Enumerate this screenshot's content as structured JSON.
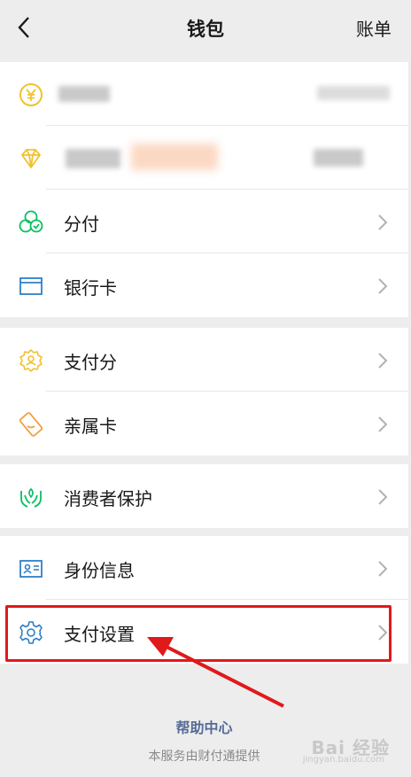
{
  "header": {
    "title": "钱包",
    "bill_label": "账单"
  },
  "menu": {
    "fenfu": "分付",
    "bank_card": "银行卡",
    "pay_score": "支付分",
    "family_card": "亲属卡",
    "consumer_protection": "消费者保护",
    "identity_info": "身份信息",
    "pay_settings": "支付设置"
  },
  "footer": {
    "help": "帮助中心",
    "note": "本服务由财付通提供"
  },
  "watermark": {
    "brand": "Bai 经验",
    "url": "jingyan.baidu.com"
  },
  "colors": {
    "accent_green": "#07c160",
    "yellow": "#f0c22e",
    "orange": "#f0a040",
    "blue": "#2f7fc7",
    "link_blue": "#576b95",
    "highlight_red": "#e0191b"
  }
}
